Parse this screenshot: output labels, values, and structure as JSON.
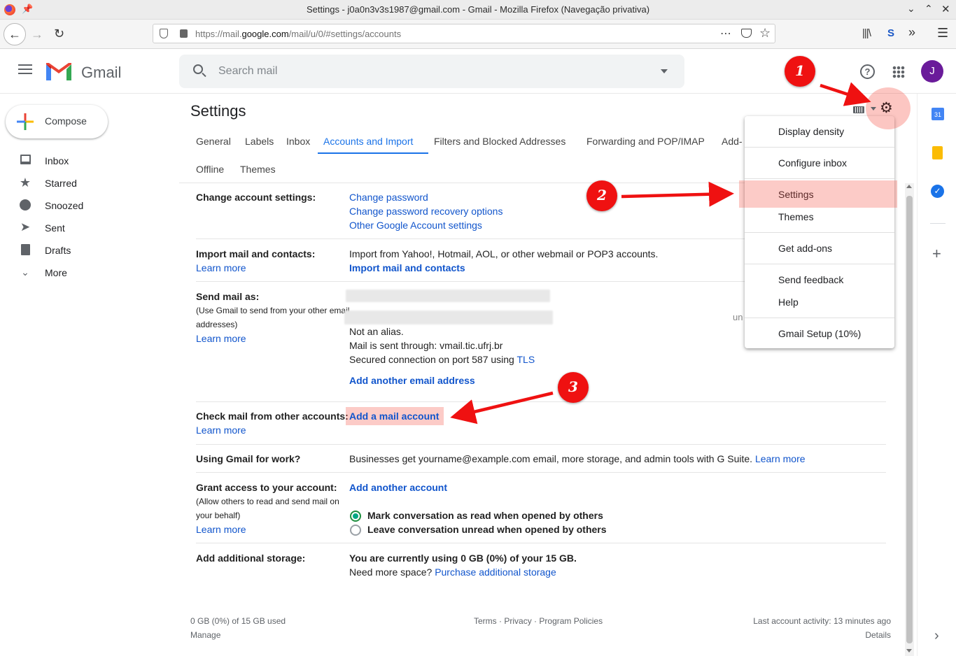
{
  "browser": {
    "title": "Settings - j0a0n3v3s1987@gmail.com - Gmail - Mozilla Firefox (Navegação privativa)",
    "url_prefix": "https://mail.",
    "url_domain": "google.com",
    "url_path": "/mail/u/0/#settings/accounts"
  },
  "gmail": {
    "logo_text": "Gmail",
    "search_placeholder": "Search mail",
    "avatar_letter": "J",
    "compose_label": "Compose"
  },
  "sidebar": {
    "items": [
      {
        "label": "Inbox",
        "icon": "inbox-icon"
      },
      {
        "label": "Starred",
        "icon": "star-icon"
      },
      {
        "label": "Snoozed",
        "icon": "clock-icon"
      },
      {
        "label": "Sent",
        "icon": "send-icon"
      },
      {
        "label": "Drafts",
        "icon": "draft-icon"
      },
      {
        "label": "More",
        "icon": "chevron-down-icon"
      }
    ]
  },
  "settings": {
    "title": "Settings",
    "tabs": [
      "General",
      "Labels",
      "Inbox",
      "Accounts and Import",
      "Filters and Blocked Addresses",
      "Forwarding and POP/IMAP",
      "Add-"
    ],
    "tabs_row2": [
      "Offline",
      "Themes"
    ],
    "active_tab": "Accounts and Import",
    "change_account": {
      "label": "Change account settings:",
      "links": [
        "Change password",
        "Change password recovery options",
        "Other Google Account settings"
      ]
    },
    "import": {
      "label": "Import mail and contacts:",
      "learn": "Learn more",
      "desc": "Import from Yahoo!, Hotmail, AOL, or other webmail or POP3 accounts.",
      "action": "Import mail and contacts"
    },
    "send_as": {
      "label": "Send mail as:",
      "sub": "(Use Gmail to send from your other email addresses)",
      "learn": "Learn more",
      "lines": [
        "Not an alias.",
        "Mail is sent through: vmail.tic.ufrj.br",
        "Secured connection on port 587 using"
      ],
      "tls": "TLS",
      "action": "Add another email address",
      "right_partial": "un"
    },
    "check_mail": {
      "label": "Check mail from other accounts:",
      "learn": "Learn more",
      "action": "Add a mail account"
    },
    "work": {
      "label": "Using Gmail for work?",
      "desc": "Businesses get yourname@example.com email, more storage, and admin tools with G Suite.",
      "learn": "Learn more"
    },
    "grant": {
      "label": "Grant access to your account:",
      "sub": "(Allow others to read and send mail on your behalf)",
      "learn": "Learn more",
      "action": "Add another account",
      "opt1": "Mark conversation as read when opened by others",
      "opt2": "Leave conversation unread when opened by others",
      "selected": 1
    },
    "storage": {
      "label": "Add additional storage:",
      "desc": "You are currently using 0 GB (0%) of your 15 GB.",
      "need": "Need more space?",
      "action": "Purchase additional storage"
    }
  },
  "footer": {
    "usage": "0 GB (0%) of 15 GB used",
    "manage": "Manage",
    "terms": "Terms",
    "privacy": "Privacy",
    "policies": "Program Policies",
    "dot": "·",
    "activity": "Last account activity: 13 minutes ago",
    "details": "Details"
  },
  "menu": {
    "items": [
      "Display density",
      "Configure inbox",
      "Settings",
      "Themes",
      "Get add-ons",
      "Send feedback",
      "Help",
      "Gmail Setup (10%)"
    ],
    "highlighted": "Settings"
  },
  "annotations": {
    "steps": [
      "1",
      "2",
      "3"
    ],
    "color": "#ef1111"
  }
}
